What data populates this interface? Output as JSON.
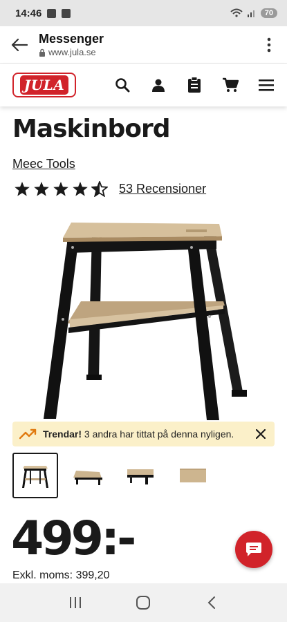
{
  "status_bar": {
    "time": "14:46",
    "battery": "70"
  },
  "app_bar": {
    "title": "Messenger",
    "url": "www.jula.se"
  },
  "site_header": {
    "logo_text": "JULA"
  },
  "product": {
    "title": "Maskinbord",
    "brand": "Meec Tools",
    "rating": 4.5,
    "reviews": "53 Recensioner",
    "price": "499:-",
    "price_ex_vat": "Exkl. moms: 399,20"
  },
  "trend_banner": {
    "label": "Trendar!",
    "text": "3 andra har tittat på denna nyligen."
  },
  "thumbnails": [
    {
      "name": "thumbnail-1",
      "active": true
    },
    {
      "name": "thumbnail-2",
      "active": false
    },
    {
      "name": "thumbnail-3",
      "active": false
    },
    {
      "name": "thumbnail-4",
      "active": false
    }
  ],
  "colors": {
    "brand_red": "#d1232a",
    "banner_yellow": "#fbf0c9",
    "trend_orange": "#e07a10"
  },
  "icons": [
    "back-arrow-icon",
    "lock-icon",
    "kebab-menu-icon",
    "search-icon",
    "user-icon",
    "clipboard-icon",
    "cart-icon",
    "hamburger-menu-icon",
    "star-icon",
    "trend-up-icon",
    "close-icon",
    "chat-icon"
  ]
}
